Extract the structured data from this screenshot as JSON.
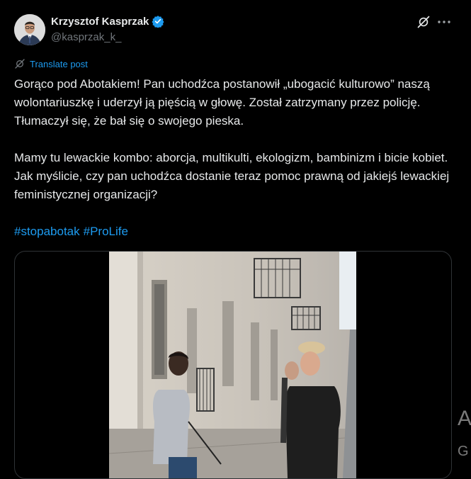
{
  "author": {
    "display_name": "Krzysztof Kasprzak",
    "handle": "@kasprzak_k_",
    "verified_icon": "verified-badge-icon"
  },
  "header_icons": [
    "grok-icon",
    "more-icon"
  ],
  "translate_label": "Translate post",
  "post_text": "Gorąco pod Abotakiem! Pan uchodźca postanowił „ubogacić kulturowo” naszą wolontariuszkę i uderzył ją pięścią w głowę. Został zatrzymany przez policję. Tłumaczył się, że bał się o swojego pieska.\n\nMamy tu lewackie kombo: aborcja, multikulti, ekologizm, bambinizm i bicie kobiet. Jak myślicie, czy pan uchodźca dostanie teraz pomoc prawną od jakiejś lewackiej feministycznej organizacji?",
  "hashtags": [
    "#stopabotak",
    "#ProLife"
  ],
  "side_letters": [
    "A",
    "G"
  ],
  "colors": {
    "link": "#1d9bf0",
    "background": "#000000",
    "text": "#e7e9ea",
    "secondary": "#71767b"
  }
}
